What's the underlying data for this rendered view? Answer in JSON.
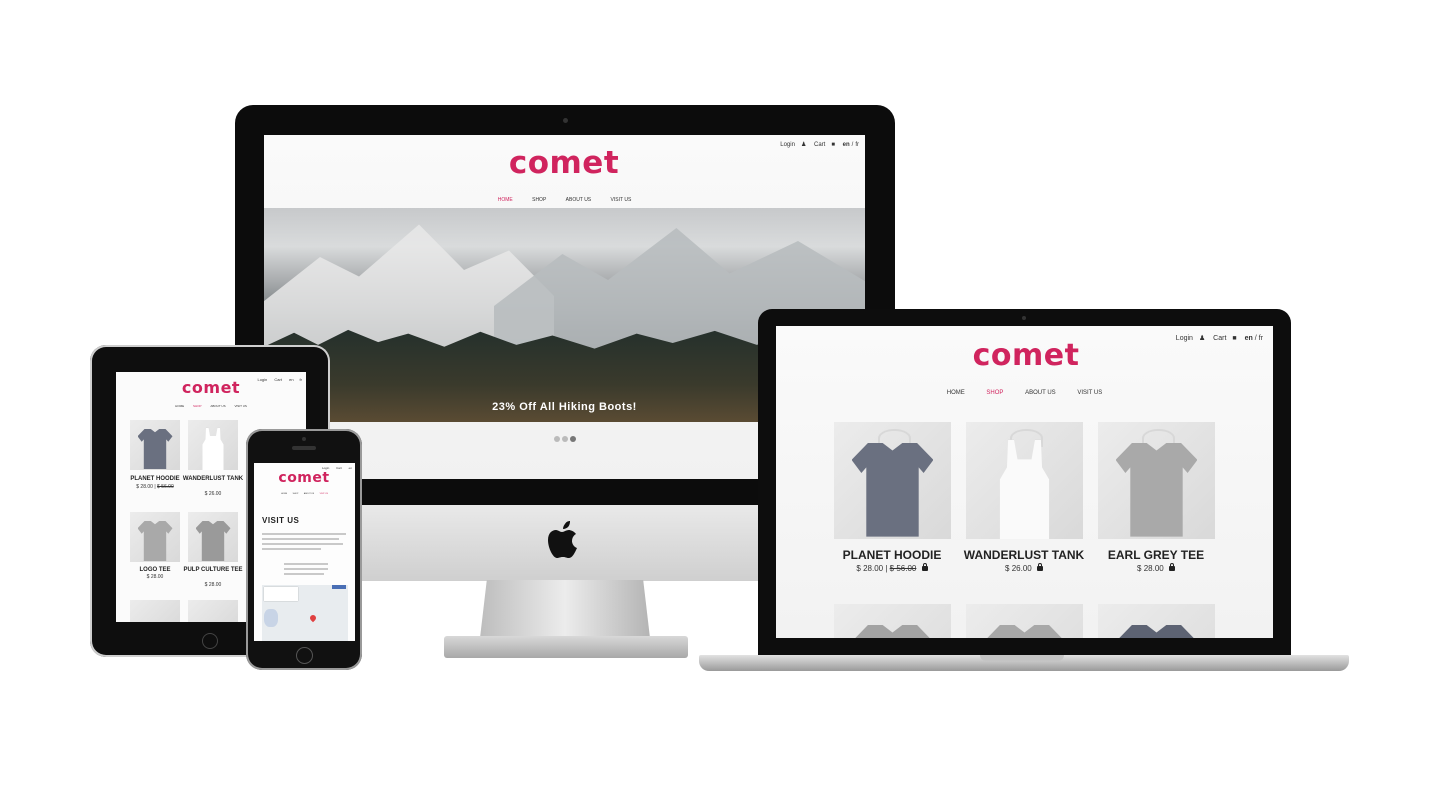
{
  "site": {
    "brand": "comet",
    "accent_color": "#d0245e",
    "utility": {
      "login": "Login",
      "cart": "Cart",
      "lang_en": "en",
      "lang_sep": "/",
      "lang_fr": "fr"
    },
    "nav": {
      "home": "HOME",
      "shop": "SHOP",
      "about": "ABOUT US",
      "visit": "VISIT US"
    }
  },
  "desktop": {
    "active_nav": "HOME",
    "hero_caption": "23% Off All Hiking Boots!",
    "slider_dots": 3,
    "slider_active_index": 2
  },
  "laptop": {
    "active_nav": "SHOP",
    "products": [
      {
        "name": "PLANET HOODIE",
        "price": "$ 28.00",
        "price_sep": "|",
        "old_price": "$ 56.00"
      },
      {
        "name": "WANDERLUST TANK",
        "price": "$ 26.00"
      },
      {
        "name": "EARL GREY TEE",
        "price": "$ 28.00"
      }
    ]
  },
  "tablet": {
    "active_nav": "SHOP",
    "products": [
      {
        "name": "PLANET HOODIE",
        "price": "$ 28.00",
        "price_sep": "|",
        "old_price": "$ 56.00"
      },
      {
        "name": "WANDERLUST TANK",
        "price": "$ 26.00"
      },
      {
        "name": "LOGO TEE",
        "price": "$ 28.00"
      },
      {
        "name": "PULP CULTURE TEE",
        "price": "$ 28.00"
      }
    ]
  },
  "phone": {
    "active_nav": "VISIT US",
    "page_title": "VISIT US"
  },
  "icons": [
    "user-icon",
    "lock-icon",
    "apple-logo-icon",
    "map-pin-icon"
  ]
}
